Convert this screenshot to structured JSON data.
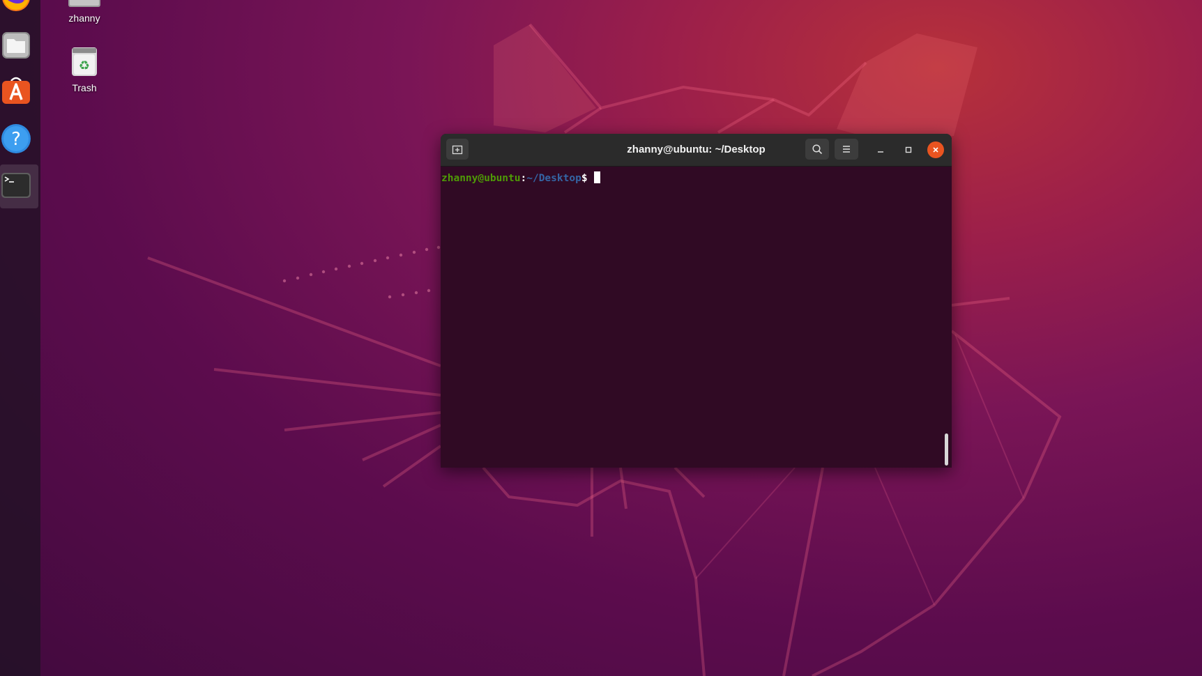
{
  "desktop": {
    "icons": [
      {
        "label": "zhanny",
        "icon": "home-folder-icon"
      },
      {
        "label": "Trash",
        "icon": "trash-icon"
      }
    ]
  },
  "dock": {
    "items": [
      {
        "icon": "firefox-icon"
      },
      {
        "icon": "files-icon"
      },
      {
        "icon": "software-icon"
      },
      {
        "icon": "help-icon"
      },
      {
        "icon": "terminal-icon",
        "active": true
      }
    ]
  },
  "terminal": {
    "title": "zhanny@ubuntu: ~/Desktop",
    "prompt": {
      "user_host": "zhanny@ubuntu",
      "separator": ":",
      "path": "~/Desktop",
      "symbol": "$"
    },
    "colors": {
      "background": "#300a24",
      "user_host": "#4e9a06",
      "path": "#3465a4",
      "close": "#e95420"
    }
  }
}
